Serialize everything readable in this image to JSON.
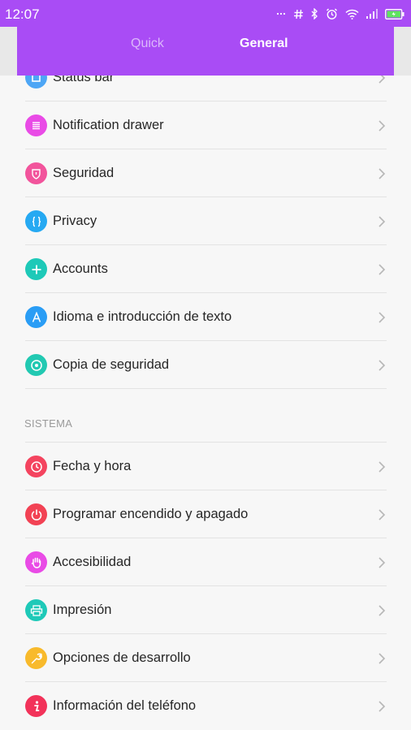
{
  "status_bar": {
    "time": "12:07"
  },
  "tabs": {
    "quick": "Quick",
    "general": "General"
  },
  "items_top": [
    {
      "label": "Status bar",
      "icon": "square-icon",
      "color": "#4da6f5"
    },
    {
      "label": "Notification drawer",
      "icon": "list-icon",
      "color": "#e94be6"
    },
    {
      "label": "Seguridad",
      "icon": "shield-icon",
      "color": "#f2549c"
    },
    {
      "label": "Privacy",
      "icon": "braces-icon",
      "color": "#26a9f2"
    },
    {
      "label": "Accounts",
      "icon": "plus-icon",
      "color": "#1ec9b8"
    },
    {
      "label": "Idioma e introducción de texto",
      "icon": "letter-a-icon",
      "color": "#2a9df5"
    },
    {
      "label": "Copia de seguridad",
      "icon": "target-icon",
      "color": "#22c9b2"
    }
  ],
  "section_system": "SISTEMA",
  "items_system": [
    {
      "label": "Fecha y hora",
      "icon": "clock-icon",
      "color": "#f4445f"
    },
    {
      "label": "Programar encendido y apagado",
      "icon": "power-icon",
      "color": "#f24254"
    },
    {
      "label": "Accesibilidad",
      "icon": "hand-icon",
      "color": "#e94be6"
    },
    {
      "label": "Impresión",
      "icon": "printer-icon",
      "color": "#1ec9b8"
    },
    {
      "label": "Opciones de desarrollo",
      "icon": "wrench-icon",
      "color": "#f8ba2c"
    },
    {
      "label": "Información del teléfono",
      "icon": "info-icon",
      "color": "#f2335a"
    }
  ]
}
